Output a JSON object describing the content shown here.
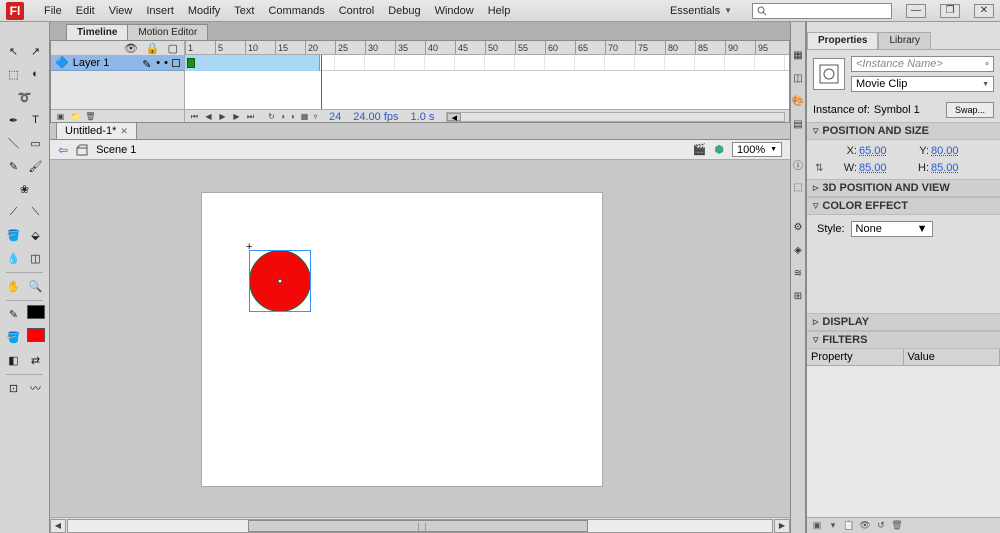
{
  "menu": {
    "items": [
      "File",
      "Edit",
      "View",
      "Insert",
      "Modify",
      "Text",
      "Commands",
      "Control",
      "Debug",
      "Window",
      "Help"
    ],
    "workspace": "Essentials"
  },
  "panels": {
    "timeline_tab": "Timeline",
    "motion_editor_tab": "Motion Editor"
  },
  "timeline": {
    "layer_name": "Layer 1",
    "ruler": [
      "1",
      "5",
      "10",
      "15",
      "20",
      "25",
      "30",
      "35",
      "40",
      "45",
      "50",
      "55",
      "60",
      "65",
      "70",
      "75",
      "80",
      "85",
      "90",
      "95"
    ],
    "current_frame": "24",
    "fps": "24.00 fps",
    "elapsed": "1.0 s"
  },
  "document": {
    "tab_name": "Untitled-1*",
    "scene": "Scene 1",
    "zoom": "100%"
  },
  "properties": {
    "tab_properties": "Properties",
    "tab_library": "Library",
    "instance_name_placeholder": "<Instance Name>",
    "type": "Movie Clip",
    "instance_of_label": "Instance of:",
    "instance_of_value": "Symbol 1",
    "swap": "Swap...",
    "sect_pos_size": "POSITION AND SIZE",
    "x_label": "X:",
    "x_value": "65.00",
    "y_label": "Y:",
    "y_value": "80.00",
    "w_label": "W:",
    "w_value": "85.00",
    "h_label": "H:",
    "h_value": "85.00",
    "sect_3d": "3D POSITION AND VIEW",
    "sect_color": "COLOR EFFECT",
    "style_label": "Style:",
    "style_value": "None",
    "sect_display": "DISPLAY",
    "sect_filters": "FILTERS",
    "col_property": "Property",
    "col_value": "Value"
  }
}
